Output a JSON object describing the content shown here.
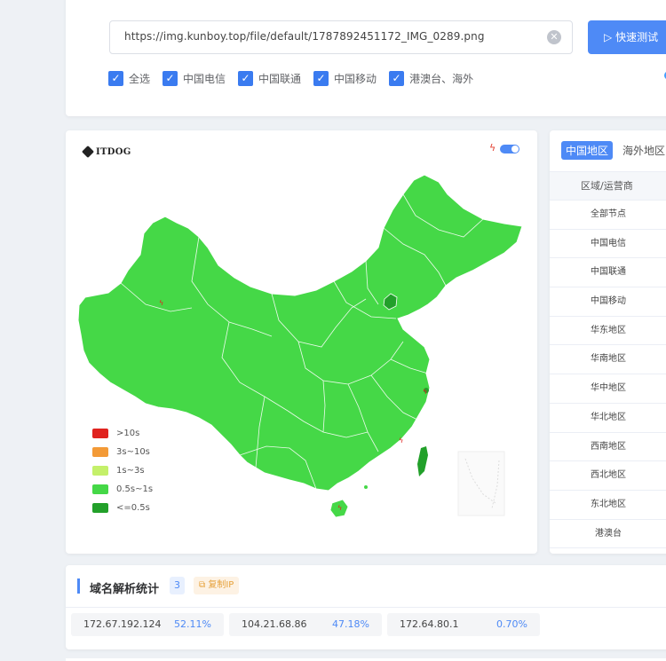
{
  "search": {
    "url": "https://img.kunboy.top/file/default/1787892451172_IMG_0289.png",
    "clear_icon": "close-circle-icon",
    "test_button": "快速测试",
    "test_icon": "play-icon"
  },
  "filters": [
    {
      "label": "全选",
      "checked": true
    },
    {
      "label": "中国电信",
      "checked": true
    },
    {
      "label": "中国联通",
      "checked": true
    },
    {
      "label": "中国移动",
      "checked": true
    },
    {
      "label": "港澳台、海外",
      "checked": true
    }
  ],
  "map": {
    "logo_text": "ITDOG",
    "toggle_on": true,
    "legend": [
      {
        "label": ">10s",
        "color": "#e0231f"
      },
      {
        "label": "3s~10s",
        "color": "#f39a37"
      },
      {
        "label": "1s~3s",
        "color": "#c4f06a"
      },
      {
        "label": "0.5s~1s",
        "color": "#45d847"
      },
      {
        "label": "<=0.5s",
        "color": "#22a02a"
      }
    ]
  },
  "regions": {
    "tabs": [
      "中国地区",
      "海外地区"
    ],
    "header": "区域/运营商",
    "rows": [
      "全部节点",
      "中国电信",
      "中国联通",
      "中国移动",
      "华东地区",
      "华南地区",
      "华中地区",
      "华北地区",
      "西南地区",
      "西北地区",
      "东北地区",
      "港澳台"
    ]
  },
  "dns": {
    "title": "域名解析统计",
    "count": "3",
    "copy_label": "复制IP",
    "ips": [
      {
        "ip": "172.67.192.124",
        "pct": "52.11%"
      },
      {
        "ip": "104.21.68.86",
        "pct": "47.18%"
      },
      {
        "ip": "172.64.80.1",
        "pct": "0.70%"
      }
    ]
  }
}
